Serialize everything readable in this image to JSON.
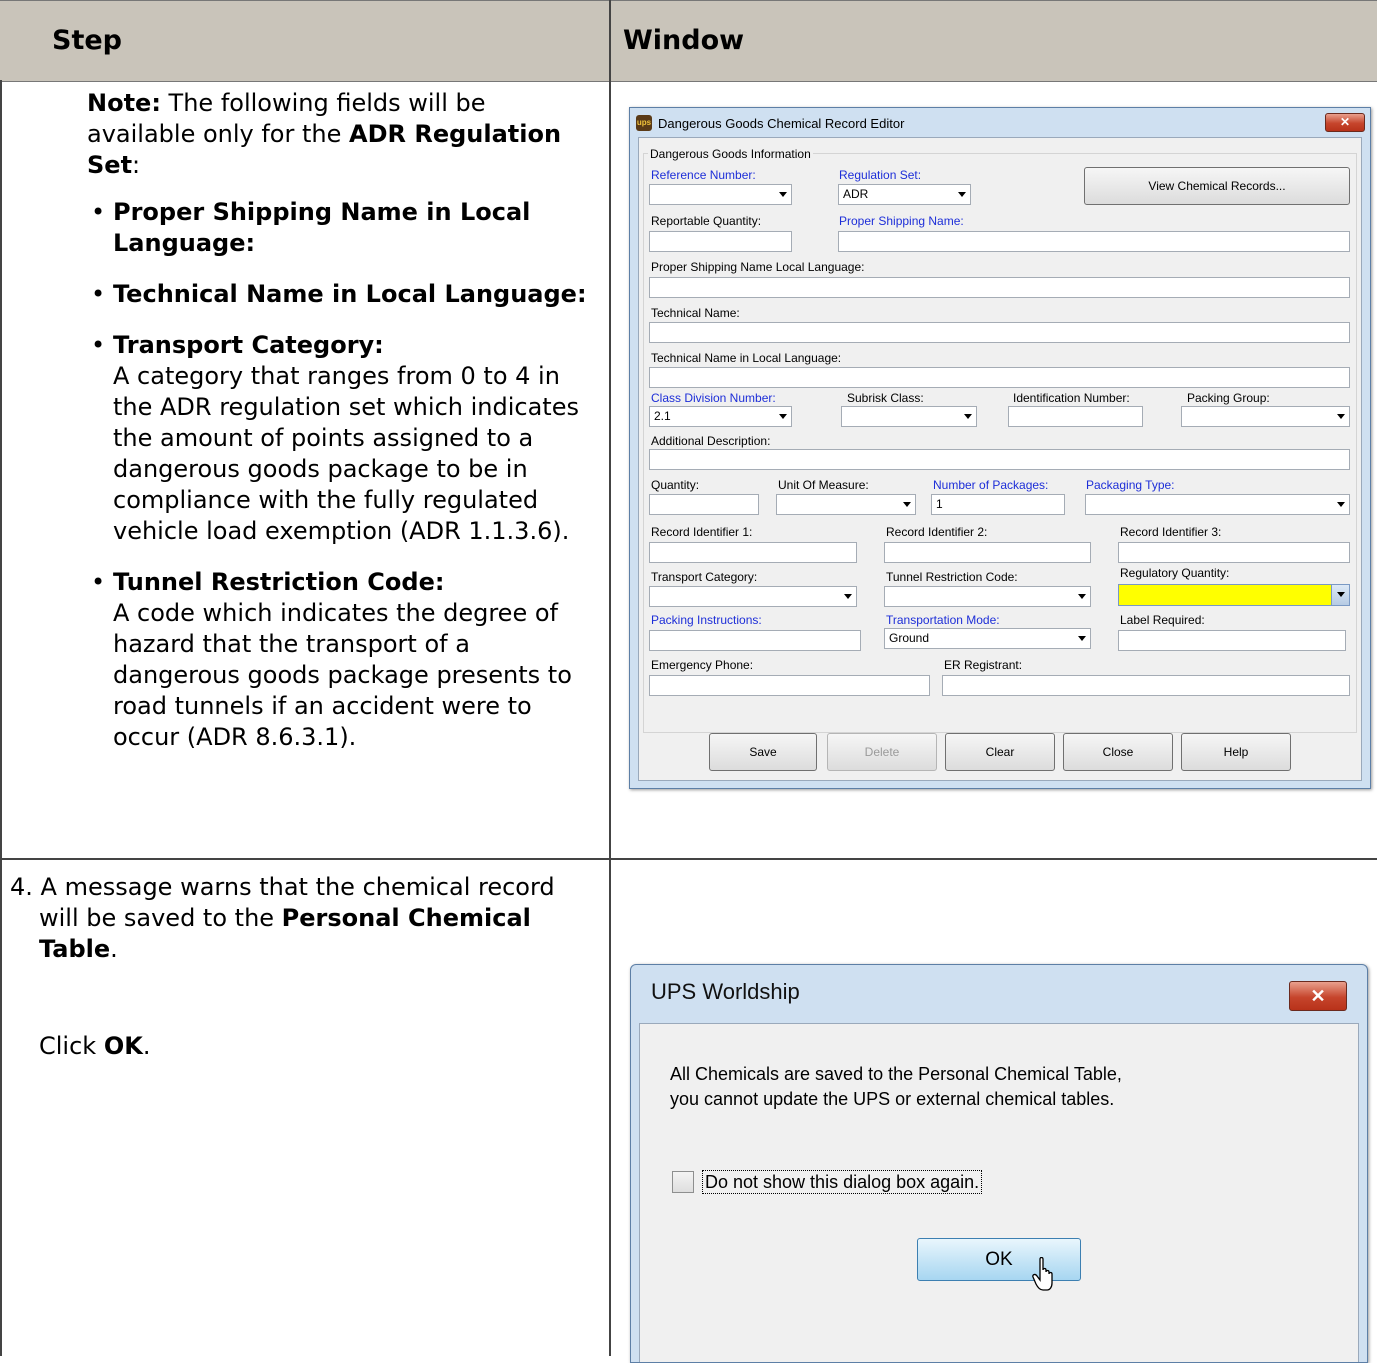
{
  "table_headers": {
    "step": "Step",
    "window": "Window"
  },
  "row1": {
    "note_label": "Note:",
    "note_text_1": " The following fields will be available only for the ",
    "note_bold": "ADR Regulation Set",
    "note_text_2": ":",
    "items": [
      {
        "title": "Proper Shipping Name in Local Language:",
        "desc": ""
      },
      {
        "title": "Technical Name in Local Language:",
        "desc": ""
      },
      {
        "title": "Transport Category:",
        "desc": "A category that ranges from 0 to 4 in the ADR regulation set which indicates the amount of points assigned to a dangerous goods package to be in compliance with the fully regulated vehicle load exemption (ADR 1.1.3.6)."
      },
      {
        "title": "Tunnel Restriction Code:",
        "desc": "A code which indicates the degree of hazard that the transport of a dangerous goods package presents to road tunnels if an accident were to occur (ADR 8.6.3.1)."
      }
    ]
  },
  "editor": {
    "title": "Dangerous Goods Chemical Record Editor",
    "group_label": "Dangerous Goods Information",
    "reference_number": {
      "label": "Reference Number:",
      "value": ""
    },
    "regulation_set": {
      "label": "Regulation Set:",
      "value": "ADR"
    },
    "view_button": "View Chemical Records...",
    "reportable_quantity": {
      "label": "Reportable Quantity:",
      "value": ""
    },
    "proper_shipping_name": {
      "label": "Proper Shipping Name:",
      "value": ""
    },
    "psn_local": {
      "label": "Proper Shipping Name Local Language:",
      "value": ""
    },
    "technical_name": {
      "label": "Technical Name:",
      "value": ""
    },
    "technical_local": {
      "label": "Technical Name in Local Language:",
      "value": ""
    },
    "class_division": {
      "label": "Class Division Number:",
      "value": "2.1"
    },
    "subrisk_class": {
      "label": "Subrisk Class:",
      "value": ""
    },
    "identification_number": {
      "label": "Identification Number:",
      "value": ""
    },
    "packing_group": {
      "label": "Packing Group:",
      "value": ""
    },
    "additional_description": {
      "label": "Additional Description:",
      "value": ""
    },
    "quantity": {
      "label": "Quantity:",
      "value": ""
    },
    "unit_of_measure": {
      "label": "Unit Of Measure:",
      "value": ""
    },
    "number_of_packages": {
      "label": "Number of Packages:",
      "value": "1"
    },
    "packaging_type": {
      "label": "Packaging Type:",
      "value": ""
    },
    "record_id_1": {
      "label": "Record Identifier 1:",
      "value": ""
    },
    "record_id_2": {
      "label": "Record Identifier 2:",
      "value": ""
    },
    "record_id_3": {
      "label": "Record Identifier 3:",
      "value": ""
    },
    "transport_category": {
      "label": "Transport Category:",
      "value": ""
    },
    "tunnel_restriction": {
      "label": "Tunnel Restriction Code:",
      "value": ""
    },
    "regulatory_quantity": {
      "label": "Regulatory Quantity:",
      "value": ""
    },
    "packing_instructions": {
      "label": "Packing Instructions:",
      "value": ""
    },
    "transportation_mode": {
      "label": "Transportation Mode:",
      "value": "Ground"
    },
    "label_required": {
      "label": "Label Required:",
      "value": ""
    },
    "emergency_phone": {
      "label": "Emergency Phone:",
      "value": ""
    },
    "er_registrant": {
      "label": "ER Registrant:",
      "value": ""
    },
    "buttons": {
      "save": "Save",
      "delete": "Delete",
      "clear": "Clear",
      "close": "Close",
      "help": "Help"
    },
    "highlight_color": "#ffff00"
  },
  "row2": {
    "number": "4.",
    "text_1": " A message warns that the chemical record will be saved to the ",
    "bold": "Personal Chemical Table",
    "text_2": ".",
    "click_prefix": "Click ",
    "click_bold": "OK",
    "click_suffix": "."
  },
  "dialog": {
    "title": "UPS Worldship",
    "message": "All Chemicals are saved to the Personal Chemical Table, you cannot update the UPS or external chemical tables.",
    "checkbox_label": "Do not show this dialog box again.",
    "checkbox_checked": false,
    "ok_button": "OK"
  }
}
